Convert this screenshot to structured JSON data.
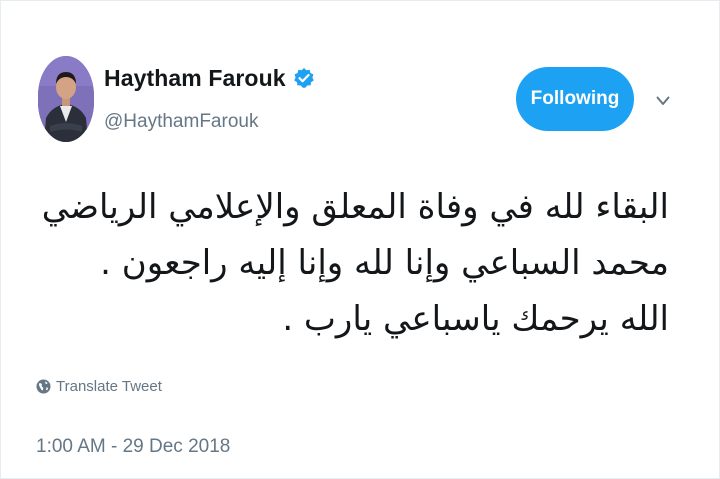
{
  "author": {
    "display_name": "Haytham Farouk",
    "handle": "@HaythamFarouk",
    "avatar": "avatar-photo",
    "verified_icon": "verified-badge-icon"
  },
  "actions": {
    "follow_label": "Following",
    "menu_icon": "chevron-down-icon"
  },
  "tweet": {
    "lines": [
      "البقاء لله في وفاة المعلق والإعلامي الرياضي",
      "محمد السباعي وإنا لله وإنا إليه راجعون .",
      "الله يرحمك ياسباعي يارب ."
    ]
  },
  "translate": {
    "icon": "globe-icon",
    "label": "Translate Tweet"
  },
  "meta": {
    "timestamp": "1:00 AM - 29 Dec 2018"
  },
  "colors": {
    "accent": "#1da1f2",
    "text_primary": "#14171a",
    "text_secondary": "#657786"
  }
}
